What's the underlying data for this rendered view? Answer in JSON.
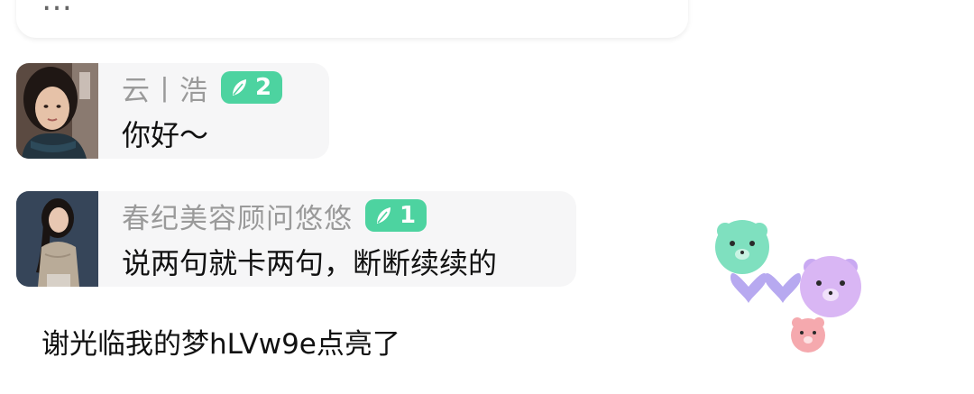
{
  "top_bubble": {
    "text": "…"
  },
  "chats": [
    {
      "avatar_alt": "user-avatar-1",
      "name": "云丨浩",
      "level": "2",
      "message": "你好～"
    },
    {
      "avatar_alt": "user-avatar-2",
      "name": "春纪美容顾问悠悠",
      "level": "1",
      "message": "说两句就卡两句，断断续续的"
    }
  ],
  "system_message": "谢光临我的梦hLVw9e点亮了",
  "colors": {
    "badge": "#4dd3a0",
    "bubble": "#f6f6f7",
    "bear_green": "#7fe0bf",
    "bear_purple": "#c9a9f2",
    "bear_pink": "#f5a9ae",
    "heart": "#b7a9f0"
  },
  "icons": {
    "badge_icon": "leaf-icon",
    "decoration": "bear-hearts-decoration"
  }
}
